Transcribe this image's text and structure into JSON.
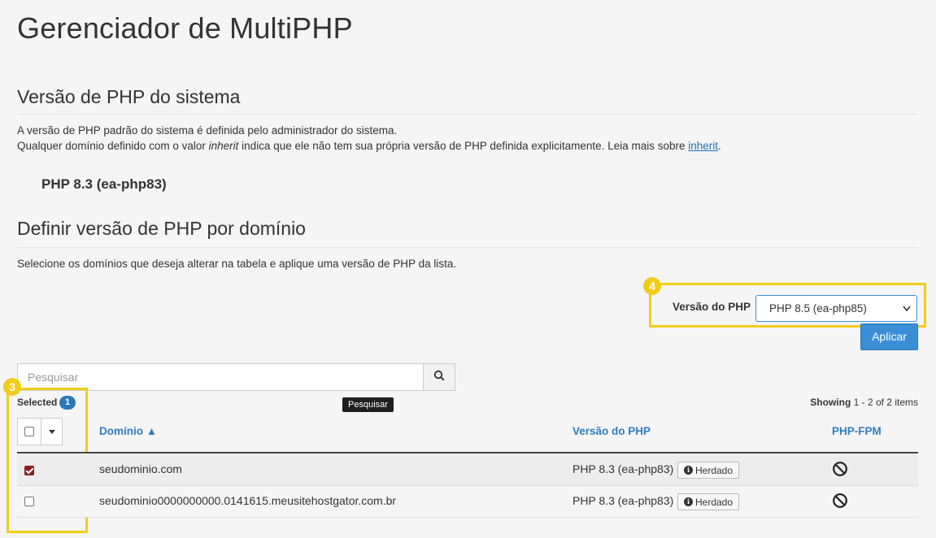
{
  "page": {
    "title": "Gerenciador de MultiPHP"
  },
  "system": {
    "heading": "Versão de PHP do sistema",
    "desc_line1": "A versão de PHP padrão do sistema é definida pelo administrador do sistema.",
    "desc_line2_a": "Qualquer domínio definido com o valor ",
    "desc_line2_em": "inherit",
    "desc_line2_b": " indica que ele não tem sua própria versão de PHP definida explicitamente. Leia mais sobre ",
    "desc_link": "inherit",
    "desc_end": ".",
    "current_version": "PHP 8.3 (ea-php83)"
  },
  "domain_section": {
    "heading": "Definir versão de PHP por domínio",
    "desc": "Selecione os domínios que deseja alterar na tabela e aplique uma versão de PHP da lista."
  },
  "php_selector": {
    "label": "Versão do PHP",
    "selected": "PHP 8.5 (ea-php85)",
    "apply_label": "Aplicar",
    "step_number": "4"
  },
  "search": {
    "placeholder": "Pesquisar",
    "tooltip": "Pesquisar"
  },
  "selection": {
    "label": "Selected",
    "count": "1",
    "step_number": "3"
  },
  "pagination": {
    "showing_label": "Showing",
    "range": "1 - 2 of 2 items"
  },
  "table": {
    "columns": {
      "domain": "Domínio ▲",
      "php_version": "Versão do PHP",
      "php_fpm": "PHP-FPM"
    },
    "rows": [
      {
        "domain": "seudominio.com",
        "php_version": "PHP 8.3 (ea-php83)",
        "badge": "Herdado",
        "checked": true
      },
      {
        "domain": "seudominio0000000000.0141615.meusitehostgator.com.br",
        "php_version": "PHP 8.3 (ea-php83)",
        "badge": "Herdado",
        "checked": false
      }
    ]
  },
  "colors": {
    "accent": "#3a8ed6",
    "link": "#2f7dbf",
    "highlight": "#f2cc1b",
    "checkbox_checked": "#8a1f1f"
  }
}
